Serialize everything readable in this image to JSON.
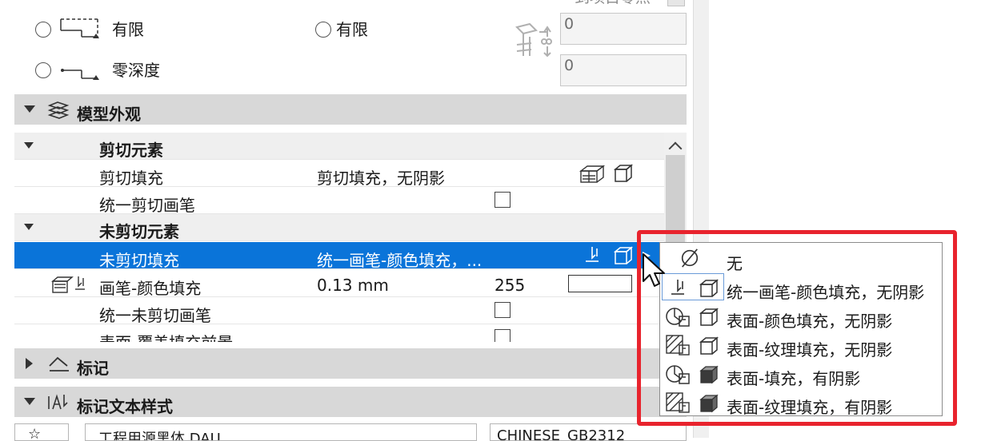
{
  "top_partial_button": "到项目零点",
  "radio_options": {
    "left_1": "有限",
    "left_2": "零深度",
    "middle_1": "有限"
  },
  "offset_fields": [
    "0",
    "0"
  ],
  "sections": {
    "model_appearance": "模型外观",
    "marker": "标记",
    "marker_text_style": "标记文本样式"
  },
  "grid": {
    "cut_group": "剪切元素",
    "cut_fill_label": "剪切填充",
    "cut_fill_value": "剪切填充，无阴影",
    "uniform_cut_pen_label": "统一剪切画笔",
    "uncut_group": "未剪切元素",
    "uncut_fill_label": "未剪切填充",
    "uncut_fill_value": "统一画笔-颜色填充，...",
    "pen_color_fill_label": "画笔-颜色填充",
    "pen_color_fill_size": "0.13 mm",
    "pen_color_fill_index": "255",
    "uniform_uncut_pen_label": "统一未剪切画笔",
    "surface_overlay_label": "表面-覆盖填充前景"
  },
  "dropdown_options": [
    "无",
    "统一画笔-颜色填充，无阴影",
    "表面-颜色填充，无阴影",
    "表面-纹理填充，无阴影",
    "表面-填充，有阴影",
    "表面-纹理填充，有阴影"
  ],
  "bottom": {
    "font_select": "工程用源黑体 DAU",
    "encoding_select": "CHINESE_GB2312"
  },
  "colors": {
    "selection": "#0a74d9",
    "highlight_frame": "#e8232d",
    "section_header": "#d8d8d8"
  }
}
